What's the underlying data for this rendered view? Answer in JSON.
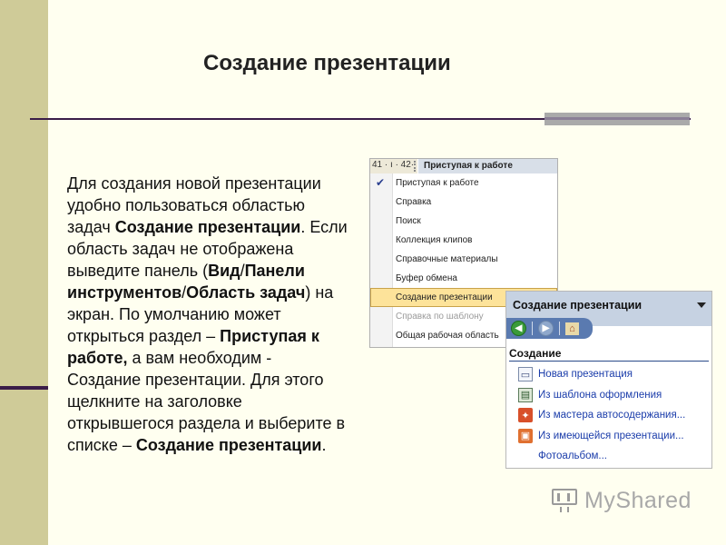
{
  "slide": {
    "title": "Создание презентации",
    "body": [
      {
        "t": "Для создания новой презентации удобно пользоваться областью задач ",
        "b": false
      },
      {
        "t": "Создание презентации",
        "b": true
      },
      {
        "t": ". Если область задач не отображена выведите панель (",
        "b": false
      },
      {
        "t": "Вид",
        "b": true
      },
      {
        "t": "/",
        "b": false
      },
      {
        "t": "Панели инструментов",
        "b": true
      },
      {
        "t": "/",
        "b": false
      },
      {
        "t": "Область задач",
        "b": true
      },
      {
        "t": ") на экран. По умолчанию может открыться раздел – ",
        "b": false
      },
      {
        "t": "Приступая к работе,",
        "b": true
      },
      {
        "t": " а вам необходим - Создание презентации. Для этого щелкните на заголовке открывшегося раздела и выберите в списке – ",
        "b": false
      },
      {
        "t": "Создание презентации",
        "b": true
      },
      {
        "t": ".",
        "b": false
      }
    ]
  },
  "menu_screenshot": {
    "ruler_text": "41 · ı · 42·",
    "header": "Приступая к работе",
    "items": [
      {
        "label": "Приступая к работе",
        "checked": true
      },
      {
        "label": "Справка"
      },
      {
        "label": "Поиск"
      },
      {
        "label": "Коллекция клипов"
      },
      {
        "label": "Справочные материалы"
      },
      {
        "label": "Буфер обмена"
      },
      {
        "label": "Создание презентации",
        "highlighted": true
      },
      {
        "label": "Справка по шаблону",
        "disabled": true
      },
      {
        "label": "Общая рабочая область"
      }
    ]
  },
  "task_pane": {
    "header": "Создание презентации",
    "section": "Создание",
    "items": [
      {
        "label": "Новая презентация",
        "icon": "new-document-icon"
      },
      {
        "label": "Из шаблона оформления",
        "icon": "design-template-icon"
      },
      {
        "label": "Из мастера автосодержания...",
        "icon": "autocontent-wizard-icon"
      },
      {
        "label": "Из имеющейся презентации...",
        "icon": "existing-presentation-icon"
      },
      {
        "label": "Фотоальбом...",
        "icon": ""
      }
    ]
  },
  "watermark": {
    "text": "MyShared"
  }
}
